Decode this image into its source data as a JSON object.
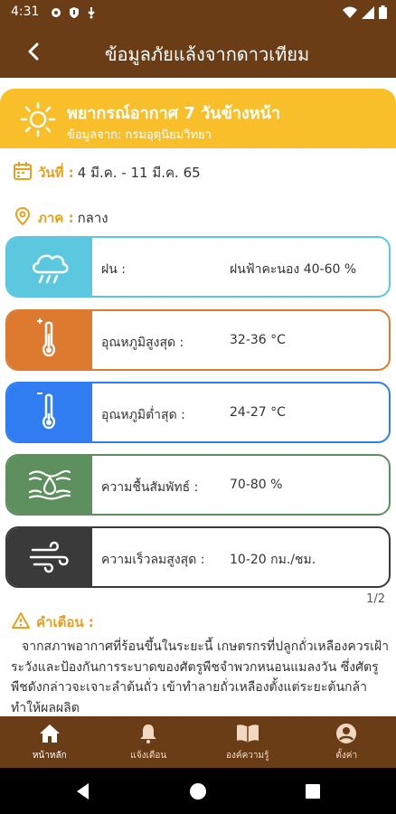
{
  "status_bar": {
    "time": "4:31",
    "icons": [
      "gear-icon",
      "shield-icon",
      "download-icon",
      "wifi-icon",
      "signal-icon",
      "battery-icon"
    ]
  },
  "app_bar": {
    "title": "ข้อมูลภัยแล้งจากดาวเทียม",
    "back_icon": "back-arrow-icon"
  },
  "forecast": {
    "title": "พยากรณ์อากาศ 7 วันข้างหน้า",
    "source": "ข้อมูลจาก: กรมอุตุนิยมวิทยา",
    "icon": "sun-icon",
    "color": "#f8bf2a"
  },
  "date_line": {
    "label": "วันที่ :",
    "value": "4 มี.ค. - 11 มี.ค. 65",
    "icon": "calendar-icon"
  },
  "region_line": {
    "label": "ภาค :",
    "value": "กลาง",
    "icon": "location-pin-icon"
  },
  "cards": [
    {
      "label": "ฝน :",
      "value": "ฝนฟ้าคะนอง 40-60 %",
      "icon": "rain-cloud-icon",
      "color": "#5bc8e0"
    },
    {
      "label": "อุณหภูมิสูงสุด :",
      "value": "32-36 °C",
      "icon": "thermometer-high-icon",
      "color": "#dd7a30"
    },
    {
      "label": "อุณหภูมิต่ำสุด :",
      "value": "24-27 °C",
      "icon": "thermometer-low-icon",
      "color": "#2f7df0"
    },
    {
      "label": "ความชื้นสัมพัทธ์ :",
      "value": "70-80 %",
      "icon": "humidity-icon",
      "color": "#5e8f5e"
    },
    {
      "label": "ความเร็วลมสูงสุด :",
      "value": "10-20 กม./ชม.",
      "icon": "wind-icon",
      "color": "#3a3a3a"
    }
  ],
  "page_indicator": "1/2",
  "warning": {
    "title": "คำเตือน :",
    "icon": "warning-icon",
    "body": "จากสภาพอากาศที่ร้อนขึ้นในระยะนี้ เกษตรกรที่ปลูกถั่วเหลืองควรเฝ้าระวังและป้องกันการระบาดของศัตรูพืชจำพวกหนอนแมลงวัน ซึ่งศัตรูพืชดังกล่าวจะเจาะลำต้นถั่ว เข้าทำลายถั่วเหลืองตั้งแต่ระยะต้นกล้า ทำให้ผลผลิต"
  },
  "bottom_nav": [
    {
      "label": "หน้าหลัก",
      "icon": "home-icon",
      "active": true
    },
    {
      "label": "แจ้งเตือน",
      "icon": "bell-icon",
      "active": false
    },
    {
      "label": "องค์ความรู้",
      "icon": "book-icon",
      "active": false
    },
    {
      "label": "ตั้งค่า",
      "icon": "profile-icon",
      "active": false
    }
  ],
  "colors": {
    "brand_brown": "#6b3d16",
    "accent_yellow": "#f8bf2a",
    "label_orange": "#e8a020"
  }
}
